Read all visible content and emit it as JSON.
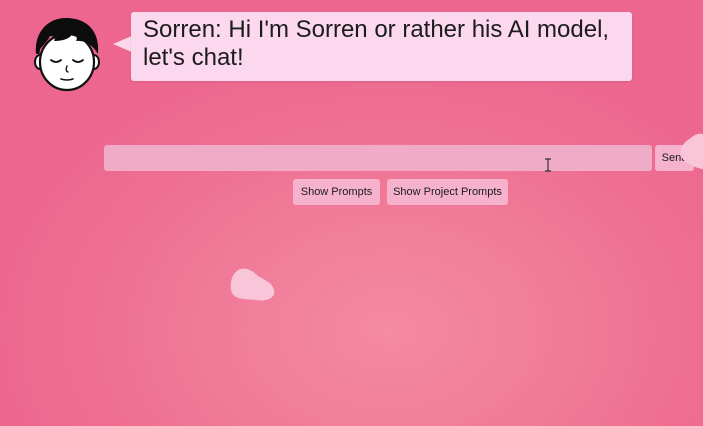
{
  "assistant": {
    "speaker": "Sorren",
    "message": "Sorren: Hi I'm Sorren or rather his AI model, let's chat!",
    "avatar_icon": "cartoon-face-avatar"
  },
  "chat": {
    "input_value": "",
    "send_label": "Send"
  },
  "prompts": {
    "show_prompts_label": "Show Prompts",
    "show_project_prompts_label": "Show Project Prompts"
  },
  "colors": {
    "background": "#ee6f92",
    "bubble": "#fbd8ee",
    "input": "#f0acc6",
    "button": "#f6b2cc",
    "blob": "#f8c6d8"
  }
}
